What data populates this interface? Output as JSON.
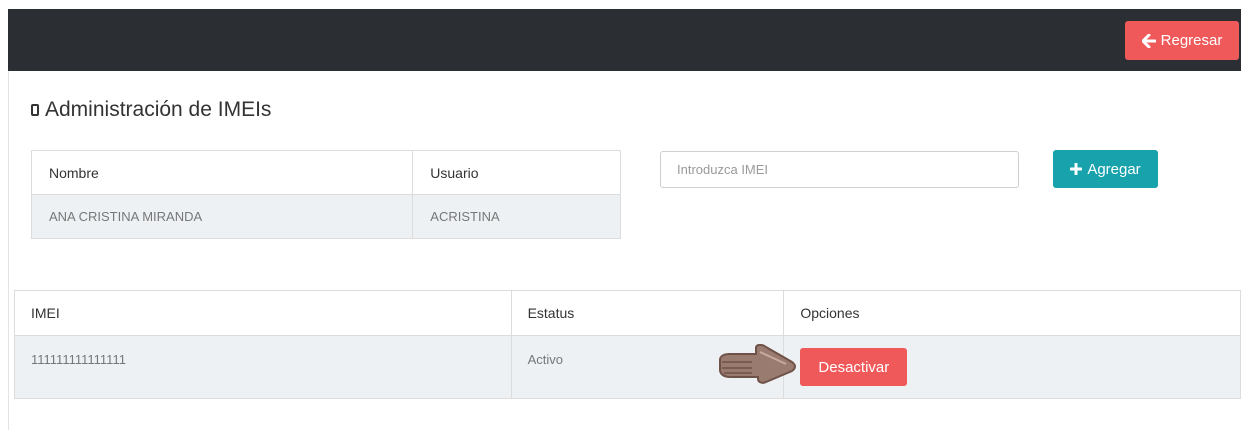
{
  "header": {
    "back_label": "Regresar",
    "back_icon": "arrow-left-icon",
    "colors": {
      "bar": "#2b2e33",
      "danger": "#f0595a",
      "teal": "#17a2ac"
    }
  },
  "page": {
    "title": "Administración de IMEIs",
    "title_icon": "mobile-phone-icon"
  },
  "user_table": {
    "headers": [
      "Nombre",
      "Usuario"
    ],
    "rows": [
      [
        "ANA CRISTINA MIRANDA",
        "ACRISTINA"
      ]
    ]
  },
  "imei_form": {
    "placeholder": "Introduzca IMEI",
    "value": "",
    "add_label": "Agregar",
    "add_icon": "plus-icon"
  },
  "imei_table": {
    "headers": [
      "IMEI",
      "Estatus",
      "Opciones"
    ],
    "rows": [
      {
        "imei": "111111111111111",
        "status": "Activo",
        "action": "Desactivar"
      }
    ]
  }
}
